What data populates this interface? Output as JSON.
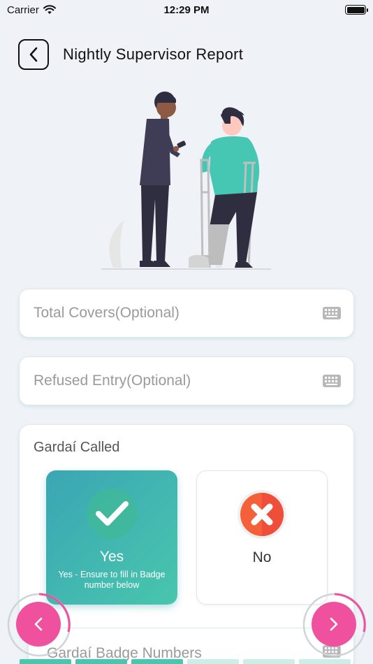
{
  "status_bar": {
    "carrier": "Carrier",
    "time": "12:29 PM"
  },
  "header": {
    "title": "Nightly Supervisor Report"
  },
  "fields": {
    "total_covers": {
      "placeholder": "Total Covers(Optional)",
      "value": ""
    },
    "refused_entry": {
      "placeholder": "Refused Entry(Optional)",
      "value": ""
    },
    "badge_numbers": {
      "placeholder": "Gardaí Badge Numbers",
      "value": ""
    }
  },
  "gardai_called": {
    "title": "Gardaí Called",
    "selected": "yes",
    "options": [
      {
        "id": "yes",
        "label": "Yes",
        "sublabel": "Yes - Ensure to fill in Badge number below"
      },
      {
        "id": "no",
        "label": "No",
        "sublabel": ""
      }
    ]
  },
  "progress": {
    "segments_total": 6,
    "segments_completed": 3
  },
  "icons": {
    "back": "chevron-left-icon",
    "keyboard": "keyboard-icon",
    "yes": "check-circle-icon",
    "no": "x-circle-icon",
    "prev": "chevron-left-icon",
    "next": "chevron-right-icon"
  },
  "colors": {
    "accent_pink": "#f0519e",
    "accent_teal": "#49c6ad",
    "no_orange": "#f4603a",
    "background": "#eff2f7"
  }
}
